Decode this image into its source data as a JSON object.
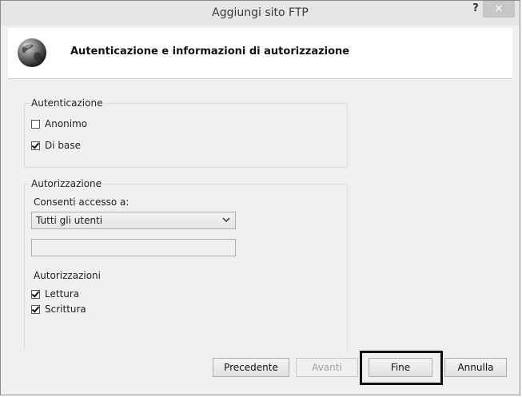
{
  "window": {
    "title": "Aggiungi sito FTP",
    "help_label": "?",
    "close_label": "✕"
  },
  "header": {
    "title": "Autenticazione e informazioni di autorizzazione",
    "icon": "globe-icon"
  },
  "authentication": {
    "legend": "Autenticazione",
    "anonymous": {
      "label": "Anonimo",
      "checked": false
    },
    "basic": {
      "label": "Di base",
      "checked": true
    }
  },
  "authorization": {
    "legend": "Autorizzazione",
    "access_label": "Consenti accesso a:",
    "access_value": "Tutti gli utenti",
    "text_value": "",
    "permissions_label": "Autorizzazioni",
    "read": {
      "label": "Lettura",
      "checked": true
    },
    "write": {
      "label": "Scrittura",
      "checked": true
    }
  },
  "footer": {
    "previous": "Precedente",
    "next": "Avanti",
    "finish": "Fine",
    "cancel": "Annulla"
  },
  "colors": {
    "window_bg": "#f0f0f0",
    "titlebar_bg": "#e6e6e6",
    "highlight_border": "#111111"
  }
}
